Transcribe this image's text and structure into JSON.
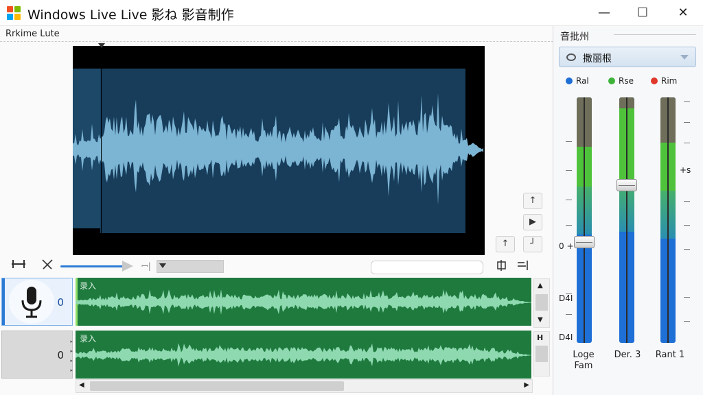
{
  "window": {
    "title": "Windows Live Live 影ね 影音制作",
    "minimize": "—",
    "maximize": "☐",
    "close": "✕"
  },
  "colors": {
    "accent": "#2b7ad6",
    "track_green": "#1f7a3e",
    "preview_blue": "#173d5b",
    "wave_blue": "#7cb4d3",
    "wave_green": "#8ed9b0"
  },
  "editor": {
    "mode_label": "Rrkime Lute",
    "nav_buttons": [
      "↑",
      "▶",
      "↑",
      "┘"
    ],
    "toolbar_icons": [
      "trim-icon",
      "split-icon",
      "align-icon",
      "align-right-icon"
    ]
  },
  "tracks": [
    {
      "label": "录入",
      "number": "0",
      "icon": "microphone-icon"
    },
    {
      "label": "录入",
      "number": "0",
      "icon": ""
    }
  ],
  "mixer": {
    "panel_title": "音批州",
    "preset": "撒丽根",
    "legend": [
      {
        "label": "Ral",
        "color": "#1e6fd6"
      },
      {
        "label": "Rse",
        "color": "#3db33a"
      },
      {
        "label": "Rim",
        "color": "#e0392b"
      }
    ],
    "scale_labels": {
      "zero": "0 +",
      "mid": "+s",
      "d1": "D4I",
      "d2": "D4I"
    },
    "channels": [
      {
        "label": "Loge Fam",
        "fader_level": 0.42
      },
      {
        "label": "Der. 3",
        "fader_level": 0.64
      },
      {
        "label": "Rant 1",
        "fader_level": null
      }
    ]
  }
}
